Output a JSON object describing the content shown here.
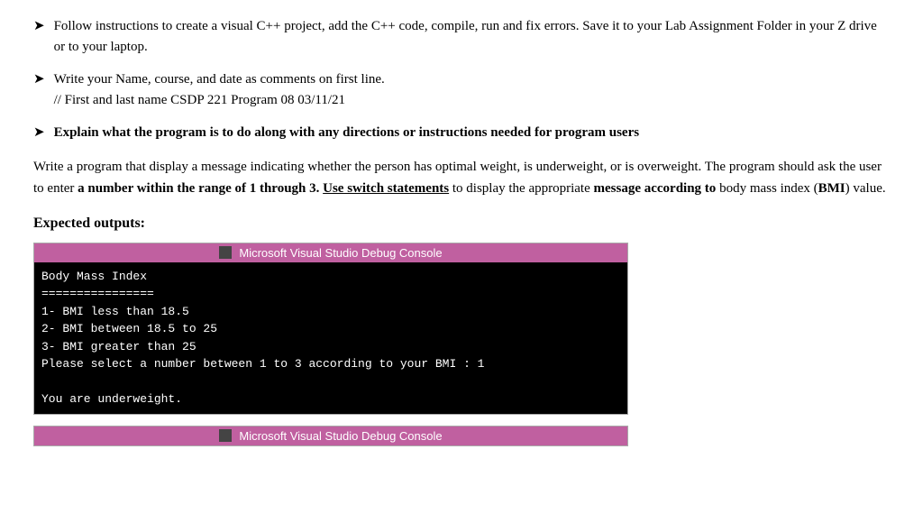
{
  "bullets": [
    {
      "id": "bullet1",
      "text": "Follow instructions to create a visual C++ project, add the C++ code, compile, run and fix errors.  Save it to your Lab Assignment Folder in your Z drive or to your laptop.",
      "bold": false
    },
    {
      "id": "bullet2",
      "line1": "Write your Name, course, and date as comments on first line.",
      "line2": "// First and last name   CSDP 221 Program 08   03/11/21",
      "bold": false,
      "multiline": true
    },
    {
      "id": "bullet3",
      "text": "Explain what the program is to do along with any directions or instructions needed for program users",
      "bold": true
    }
  ],
  "paragraph": "Write a program that display a message indicating whether the person has optimal weight, is underweight, or is overweight. The program should ask the user to enter a number within the range of 1 through 3. Use switch statements to display the appropriate message according to body mass index (BMI) value.",
  "expected_heading": "Expected outputs:",
  "console1": {
    "title": "Microsoft Visual Studio Debug Console",
    "lines": [
      "Body Mass Index",
      "================",
      "1- BMI less than 18.5",
      "2- BMI between 18.5  to 25",
      "3- BMI greater than 25",
      "Please select a number between 1 to 3 according to your BMI : 1",
      "",
      "You are underweight."
    ]
  },
  "console2": {
    "title": "Microsoft Visual Studio Debug Console",
    "lines": []
  }
}
